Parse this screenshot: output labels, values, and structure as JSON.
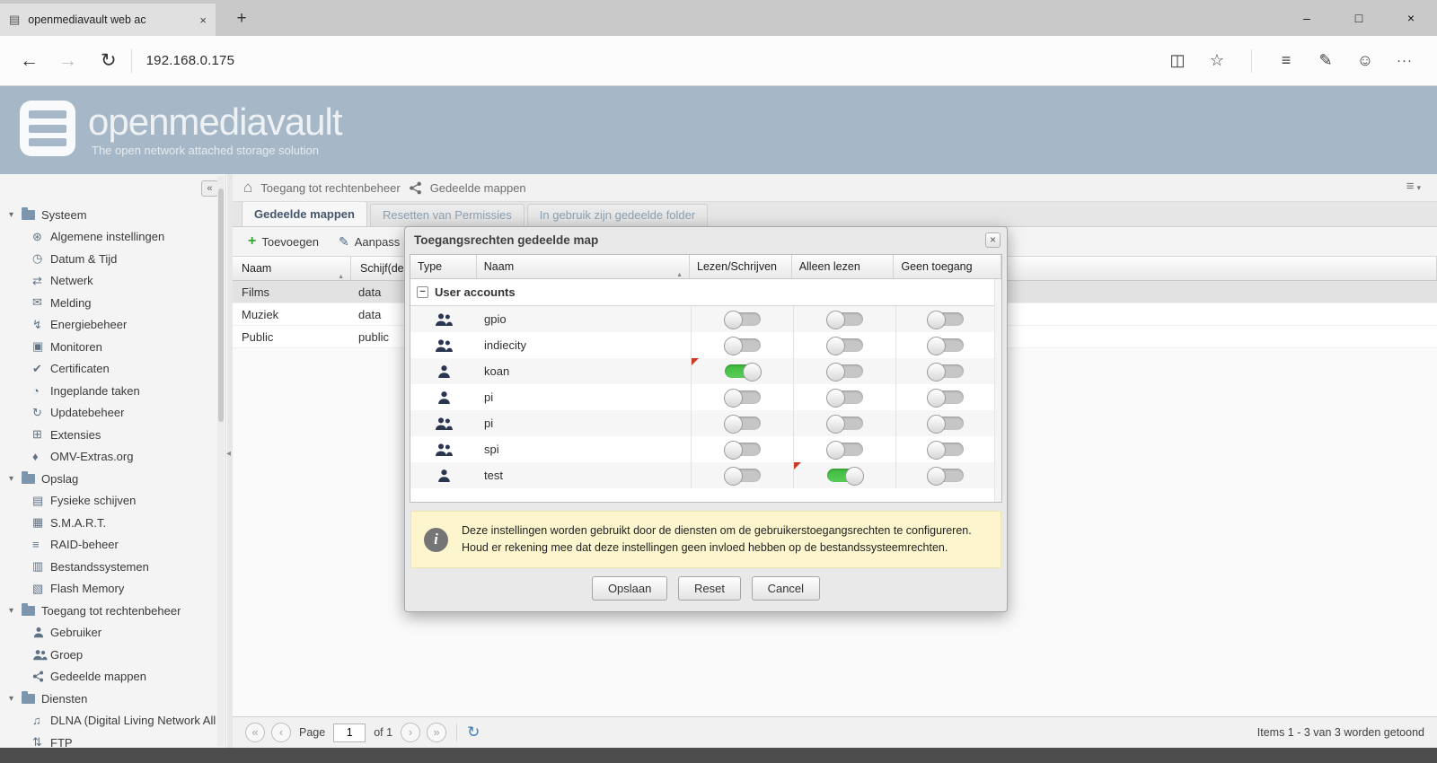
{
  "browser": {
    "tab_title": "openmediavault web ac",
    "url": "192.168.0.175"
  },
  "icons": {
    "page": "▤",
    "tab_close": "×",
    "new_tab": "+",
    "minimize": "–",
    "maximize": "□",
    "close": "×",
    "back": "←",
    "forward": "→",
    "refresh": "↻",
    "reading_view": "◫",
    "favorites": "☆",
    "hub": "≡",
    "web_note": "✎",
    "feedback": "☺",
    "more": "···",
    "home": "⌂",
    "panel_menu": "≡",
    "caret_down": "▾",
    "expand_arrow": "▾",
    "add": "+",
    "edit": "✎",
    "sort_asc": "▲",
    "collapse_sidebar": "«",
    "splitter_collapse": "◂",
    "group_collapse": "−",
    "page_first": "«",
    "page_prev": "‹",
    "page_next": "›",
    "page_last": "»",
    "pager_refresh": "↻",
    "info": "i",
    "dialog_close": "×"
  },
  "header": {
    "title": "openmediavault",
    "subtitle": "The open network attached storage solution"
  },
  "sidebar": {
    "items": [
      {
        "label": "Systeem",
        "folder": true
      },
      {
        "label": "Algemene instellingen",
        "child": true,
        "icon": "settings-icon"
      },
      {
        "label": "Datum & Tijd",
        "child": true,
        "icon": "clock-icon"
      },
      {
        "label": "Netwerk",
        "child": true,
        "icon": "network-icon"
      },
      {
        "label": "Melding",
        "child": true,
        "icon": "mail-icon"
      },
      {
        "label": "Energiebeheer",
        "child": true,
        "icon": "power-icon"
      },
      {
        "label": "Monitoren",
        "child": true,
        "icon": "monitor-icon"
      },
      {
        "label": "Certificaten",
        "child": true,
        "icon": "certificate-icon"
      },
      {
        "label": "Ingeplande taken",
        "child": true,
        "icon": "scheduled-tasks-icon"
      },
      {
        "label": "Updatebeheer",
        "child": true,
        "icon": "update-icon"
      },
      {
        "label": "Extensies",
        "child": true,
        "icon": "extensions-icon"
      },
      {
        "label": "OMV-Extras.org",
        "child": true,
        "icon": "extras-icon"
      },
      {
        "label": "Opslag",
        "folder": true
      },
      {
        "label": "Fysieke schijven",
        "child": true,
        "icon": "disk-icon"
      },
      {
        "label": "S.M.A.R.T.",
        "child": true,
        "icon": "smart-icon"
      },
      {
        "label": "RAID-beheer",
        "child": true,
        "icon": "raid-icon"
      },
      {
        "label": "Bestandssystemen",
        "child": true,
        "icon": "filesystem-icon"
      },
      {
        "label": "Flash Memory",
        "child": true,
        "icon": "flash-icon"
      },
      {
        "label": "Toegang tot rechtenbeheer",
        "folder": true
      },
      {
        "label": "Gebruiker",
        "child": true,
        "icon": "user-icon"
      },
      {
        "label": "Groep",
        "child": true,
        "icon": "group-icon"
      },
      {
        "label": "Gedeelde mappen",
        "child": true,
        "icon": "share-icon"
      },
      {
        "label": "Diensten",
        "folder": true
      },
      {
        "label": "DLNA (Digital Living Network All",
        "child": true,
        "icon": "dlna-icon"
      },
      {
        "label": "FTP",
        "child": true,
        "icon": "ftp-icon"
      }
    ]
  },
  "breadcrumb": {
    "section": "Toegang tot rechtenbeheer",
    "page": "Gedeelde mappen"
  },
  "tabs": [
    {
      "label": "Gedeelde mappen",
      "active": true
    },
    {
      "label": "Resetten van Permissies"
    },
    {
      "label": "In gebruik zijn gedeelde folder"
    }
  ],
  "toolbar": {
    "add_label": "Toevoegen",
    "edit_label": "Aanpass"
  },
  "table": {
    "columns": [
      "Naam",
      "Schijf(de"
    ],
    "rows": [
      {
        "naam": "Films",
        "schijf": "data",
        "selected": true
      },
      {
        "naam": "Muziek",
        "schijf": "data"
      },
      {
        "naam": "Public",
        "schijf": "public"
      }
    ]
  },
  "pager": {
    "page_label": "Page",
    "page": "1",
    "of_label": "of 1",
    "status": "Items 1 - 3 van 3 worden getoond"
  },
  "dialog": {
    "title": "Toegangsrechten gedeelde map",
    "columns": [
      "Type",
      "Naam",
      "Lezen/Schrijven",
      "Alleen lezen",
      "Geen toegang"
    ],
    "group_label": "User accounts",
    "rows": [
      {
        "name": "gpio",
        "is_group": true
      },
      {
        "name": "indiecity",
        "is_group": true
      },
      {
        "name": "koan",
        "is_user": true,
        "rw": true,
        "rw_dirty": true
      },
      {
        "name": "pi",
        "is_user": true
      },
      {
        "name": "pi",
        "is_group": true
      },
      {
        "name": "spi",
        "is_group": true
      },
      {
        "name": "test",
        "is_user": true,
        "ro": true,
        "ro_dirty": true
      }
    ],
    "info": "Deze instellingen worden gebruikt door de diensten om de gebruikerstoegangsrechten te configureren. Houd er rekening mee dat deze instellingen geen invloed hebben op de bestandssysteemrechten.",
    "buttons": [
      "Opslaan",
      "Reset",
      "Cancel"
    ]
  },
  "colors": {
    "omv_header": "#a6b8c7",
    "toggle_on": "#4fc44f",
    "dirty_flag": "#cc3927",
    "info_bg": "#fcf5cd"
  }
}
